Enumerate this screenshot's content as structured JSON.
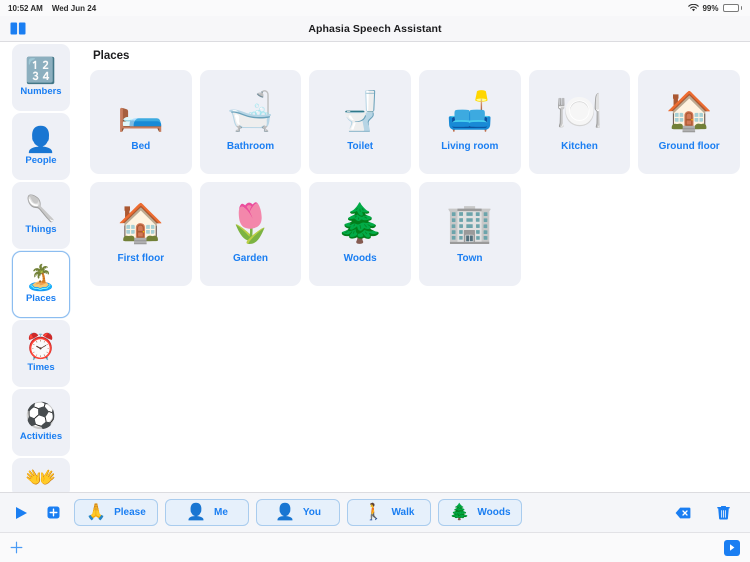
{
  "statusbar": {
    "time": "10:52 AM",
    "date": "Wed Jun 24",
    "battery_percent": "99%",
    "wifi_icon": "wifi-icon",
    "battery_icon": "battery-icon"
  },
  "navbar": {
    "title": "Aphasia Speech Assistant",
    "left_icon": "book-icon"
  },
  "sidebar": {
    "items": [
      {
        "label": "Numbers",
        "emoji": "🔢",
        "icon": "numbers-icon",
        "selected": false,
        "clipped": false
      },
      {
        "label": "People",
        "emoji": "👤",
        "icon": "person-icon",
        "selected": false,
        "clipped": false
      },
      {
        "label": "Things",
        "emoji": "🥄",
        "icon": "spoon-icon",
        "selected": false,
        "clipped": false
      },
      {
        "label": "Places",
        "emoji": "🏝️",
        "icon": "island-icon",
        "selected": true,
        "clipped": false
      },
      {
        "label": "Times",
        "emoji": "⏰",
        "icon": "alarm-clock-icon",
        "selected": false,
        "clipped": false
      },
      {
        "label": "Activities",
        "emoji": "⚽",
        "icon": "soccer-ball-icon",
        "selected": false,
        "clipped": false
      },
      {
        "label": "",
        "emoji": "👐",
        "icon": "open-hands-icon",
        "selected": false,
        "clipped": true
      }
    ]
  },
  "main": {
    "section_title": "Places",
    "cards": [
      {
        "label": "Bed",
        "emoji": "🛏️",
        "icon": "bed-icon"
      },
      {
        "label": "Bathroom",
        "emoji": "🛁",
        "icon": "bathtub-icon"
      },
      {
        "label": "Toilet",
        "emoji": "🚽",
        "icon": "toilet-icon"
      },
      {
        "label": "Living room",
        "emoji": "🛋️",
        "icon": "couch-and-lamp-icon"
      },
      {
        "label": "Kitchen",
        "emoji": "🍽️",
        "icon": "fork-knife-plate-icon"
      },
      {
        "label": "Ground floor",
        "emoji": "🏠",
        "icon": "house-icon"
      },
      {
        "label": "First floor",
        "emoji": "🏠",
        "icon": "house-icon"
      },
      {
        "label": "Garden",
        "emoji": "🌷",
        "icon": "tulip-icon"
      },
      {
        "label": "Woods",
        "emoji": "🌲",
        "icon": "evergreen-tree-icon"
      },
      {
        "label": "Town",
        "emoji": "🏢",
        "icon": "office-building-icon"
      }
    ]
  },
  "sentence_bar": {
    "play_icon": "play-icon",
    "add_icon": "plus-square-icon",
    "backspace_icon": "backspace-icon",
    "trash_icon": "trash-icon",
    "chips": [
      {
        "label": "Please",
        "emoji": "🙏",
        "icon": "folded-hands-icon"
      },
      {
        "label": "Me",
        "emoji": "👤",
        "icon": "person-icon"
      },
      {
        "label": "You",
        "emoji": "👤",
        "icon": "person-icon"
      },
      {
        "label": "Walk",
        "emoji": "🚶",
        "icon": "walking-person-icon"
      },
      {
        "label": "Woods",
        "emoji": "🌲",
        "icon": "evergreen-tree-icon"
      }
    ]
  },
  "toolbar": {
    "add_icon": "plus-icon",
    "play_icon": "play-filled-icon"
  },
  "colors": {
    "accent_blue": "#1a7ef2",
    "card_bg": "#eef0f6",
    "chip_bg": "#e6f0fb",
    "battery_green": "#34c759"
  }
}
